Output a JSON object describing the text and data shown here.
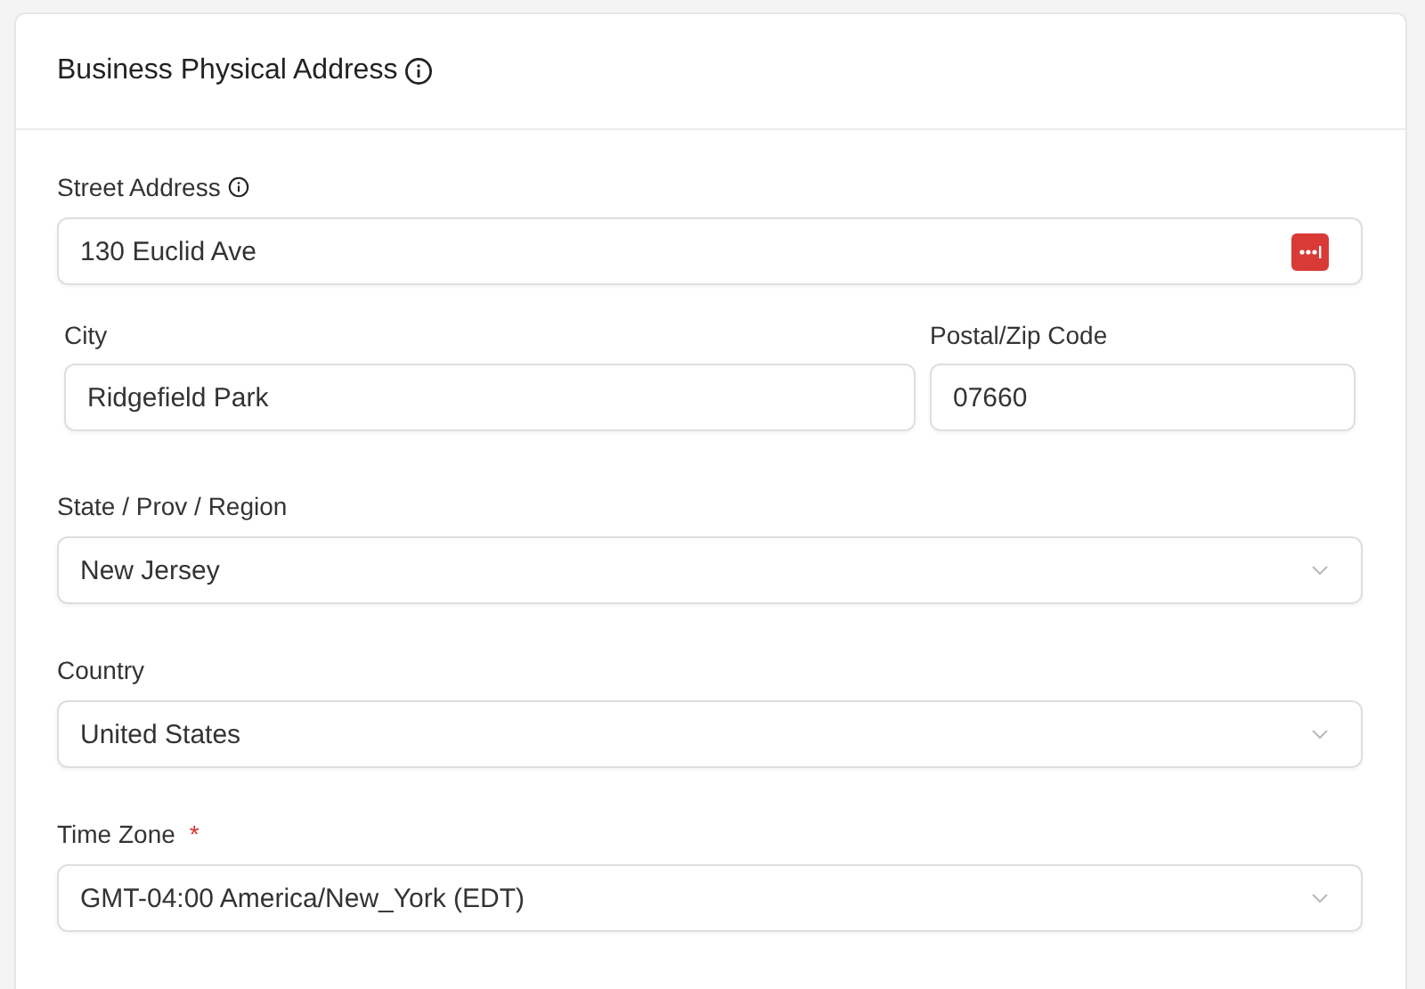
{
  "card": {
    "title": "Business Physical Address"
  },
  "street": {
    "label": "Street Address",
    "value": "130 Euclid Ave"
  },
  "city": {
    "label": "City",
    "value": "Ridgefield Park"
  },
  "postal": {
    "label": "Postal/Zip Code",
    "value": "07660"
  },
  "selects": [
    {
      "label": "State / Prov / Region",
      "value": "New Jersey"
    },
    {
      "label": "Country",
      "value": "United States"
    },
    {
      "label": "Time Zone",
      "value": "GMT-04:00 America/New_York (EDT)",
      "required_mark": "*"
    }
  ]
}
